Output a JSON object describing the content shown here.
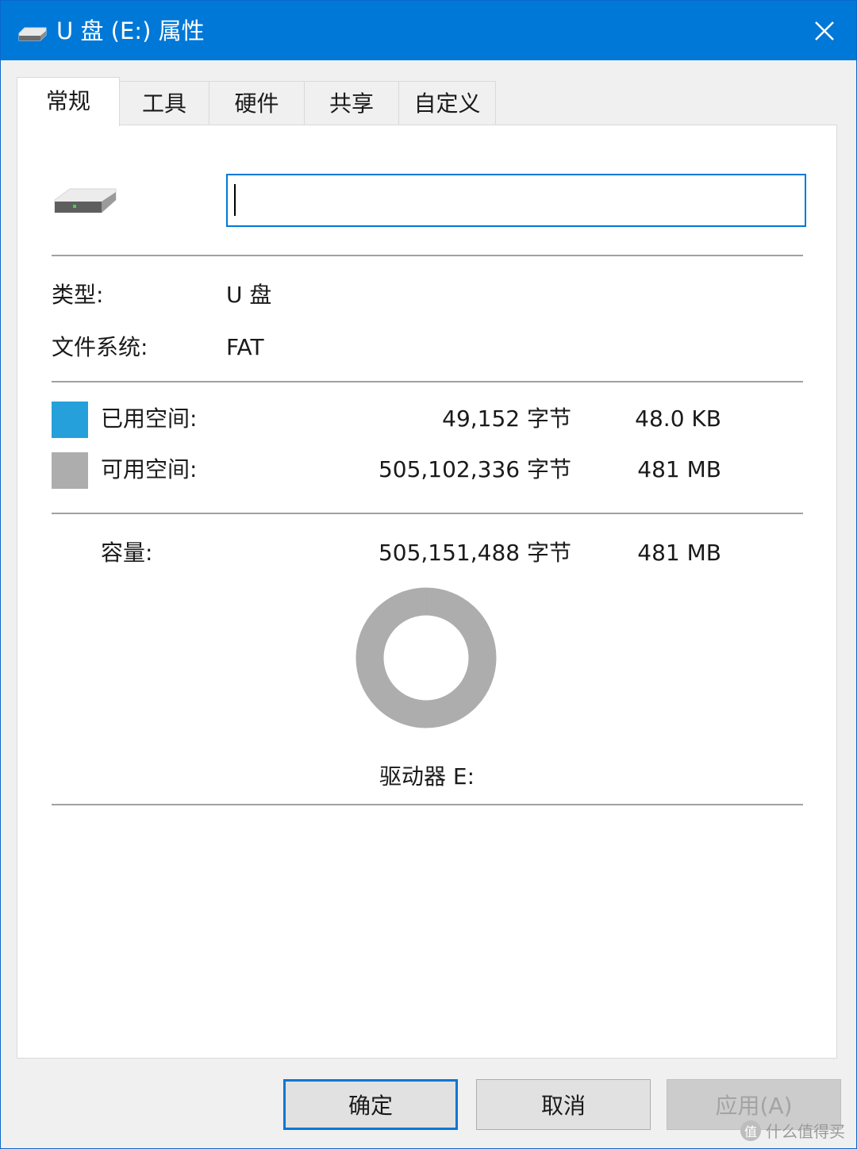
{
  "window": {
    "title": "U 盘 (E:) 属性",
    "title_bar_color": "#0078d7"
  },
  "tabs": [
    {
      "label": "常规",
      "active": true
    },
    {
      "label": "工具",
      "active": false
    },
    {
      "label": "硬件",
      "active": false
    },
    {
      "label": "共享",
      "active": false
    },
    {
      "label": "自定义",
      "active": false
    }
  ],
  "general": {
    "volume_label_value": "",
    "type_label": "类型:",
    "type_value": "U 盘",
    "fs_label": "文件系统:",
    "fs_value": "FAT",
    "used_label": "已用空间:",
    "used_bytes": "49,152 字节",
    "used_size": "48.0 KB",
    "used_color": "#26a0da",
    "free_label": "可用空间:",
    "free_bytes": "505,102,336 字节",
    "free_size": "481 MB",
    "free_color": "#adadad",
    "capacity_label": "容量:",
    "capacity_bytes": "505,151,488 字节",
    "capacity_size": "481 MB",
    "drive_caption": "驱动器 E:",
    "used_fraction": 9.73e-05
  },
  "buttons": {
    "ok": "确定",
    "cancel": "取消",
    "apply": "应用(A)"
  },
  "watermark": {
    "badge": "值",
    "text": "什么值得买"
  }
}
